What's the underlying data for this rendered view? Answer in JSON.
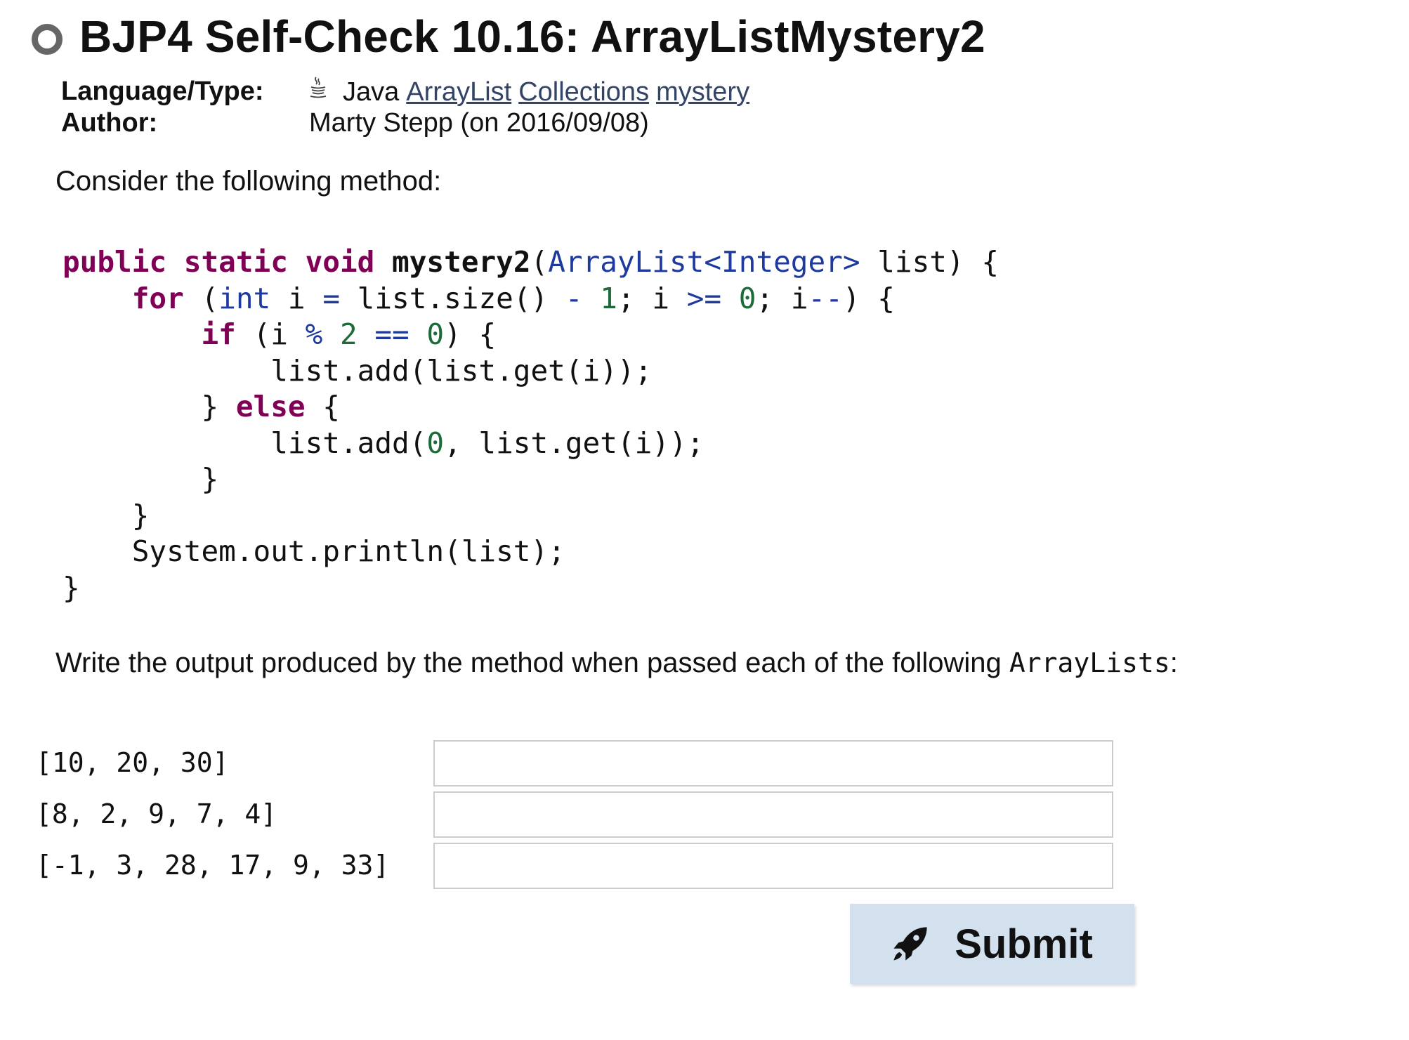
{
  "header": {
    "title": "BJP4 Self-Check 10.16: ArrayListMystery2"
  },
  "meta": {
    "language_label": "Language/Type:",
    "language_value": "Java",
    "tags": [
      "ArrayList",
      "Collections",
      "mystery"
    ],
    "author_label": "Author:",
    "author_value": "Marty Stepp (on 2016/09/08)"
  },
  "prompt": {
    "intro": "Consider the following method:",
    "instruction_before": "Write the output produced by the method when passed each of the following ",
    "instruction_code": "ArrayLists",
    "instruction_after": ":"
  },
  "code": {
    "lines": [
      "public static void mystery2(ArrayList<Integer> list) {",
      "    for (int i = list.size() - 1; i >= 0; i--) {",
      "        if (i % 2 == 0) {",
      "            list.add(list.get(i));",
      "        } else {",
      "            list.add(0, list.get(i));",
      "        }",
      "    }",
      "    System.out.println(list);",
      "}"
    ]
  },
  "answers": [
    {
      "label": "[10, 20, 30]",
      "value": ""
    },
    {
      "label": "[8, 2, 9, 7, 4]",
      "value": ""
    },
    {
      "label": "[-1, 3, 28, 17, 9, 33]",
      "value": ""
    }
  ],
  "submit": {
    "label": "Submit",
    "icon": "rocket-icon",
    "background": "#d3e1ee"
  }
}
